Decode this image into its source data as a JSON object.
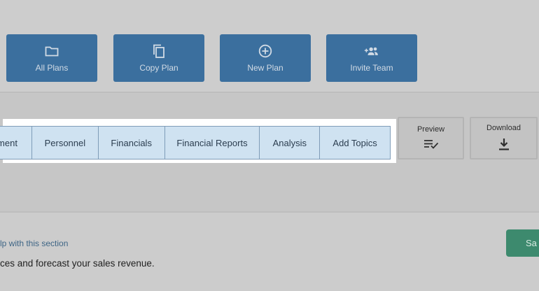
{
  "toolbar": {
    "all_plans": "All Plans",
    "copy_plan": "Copy Plan",
    "new_plan": "New Plan",
    "invite_team": "Invite Team"
  },
  "tabs": [
    "ment",
    "Personnel",
    "Financials",
    "Financial Reports",
    "Analysis",
    "Add Topics"
  ],
  "actions": {
    "preview": "Preview",
    "download": "Download"
  },
  "section": {
    "help_link": "lp with this section",
    "hint": "ces and forecast your sales revenue.",
    "save_label": "Sa"
  },
  "colors": {
    "toolbar_button": "#3b6f9e",
    "tab_background": "#cfe2f1",
    "save_button": "#3d8a6e"
  }
}
